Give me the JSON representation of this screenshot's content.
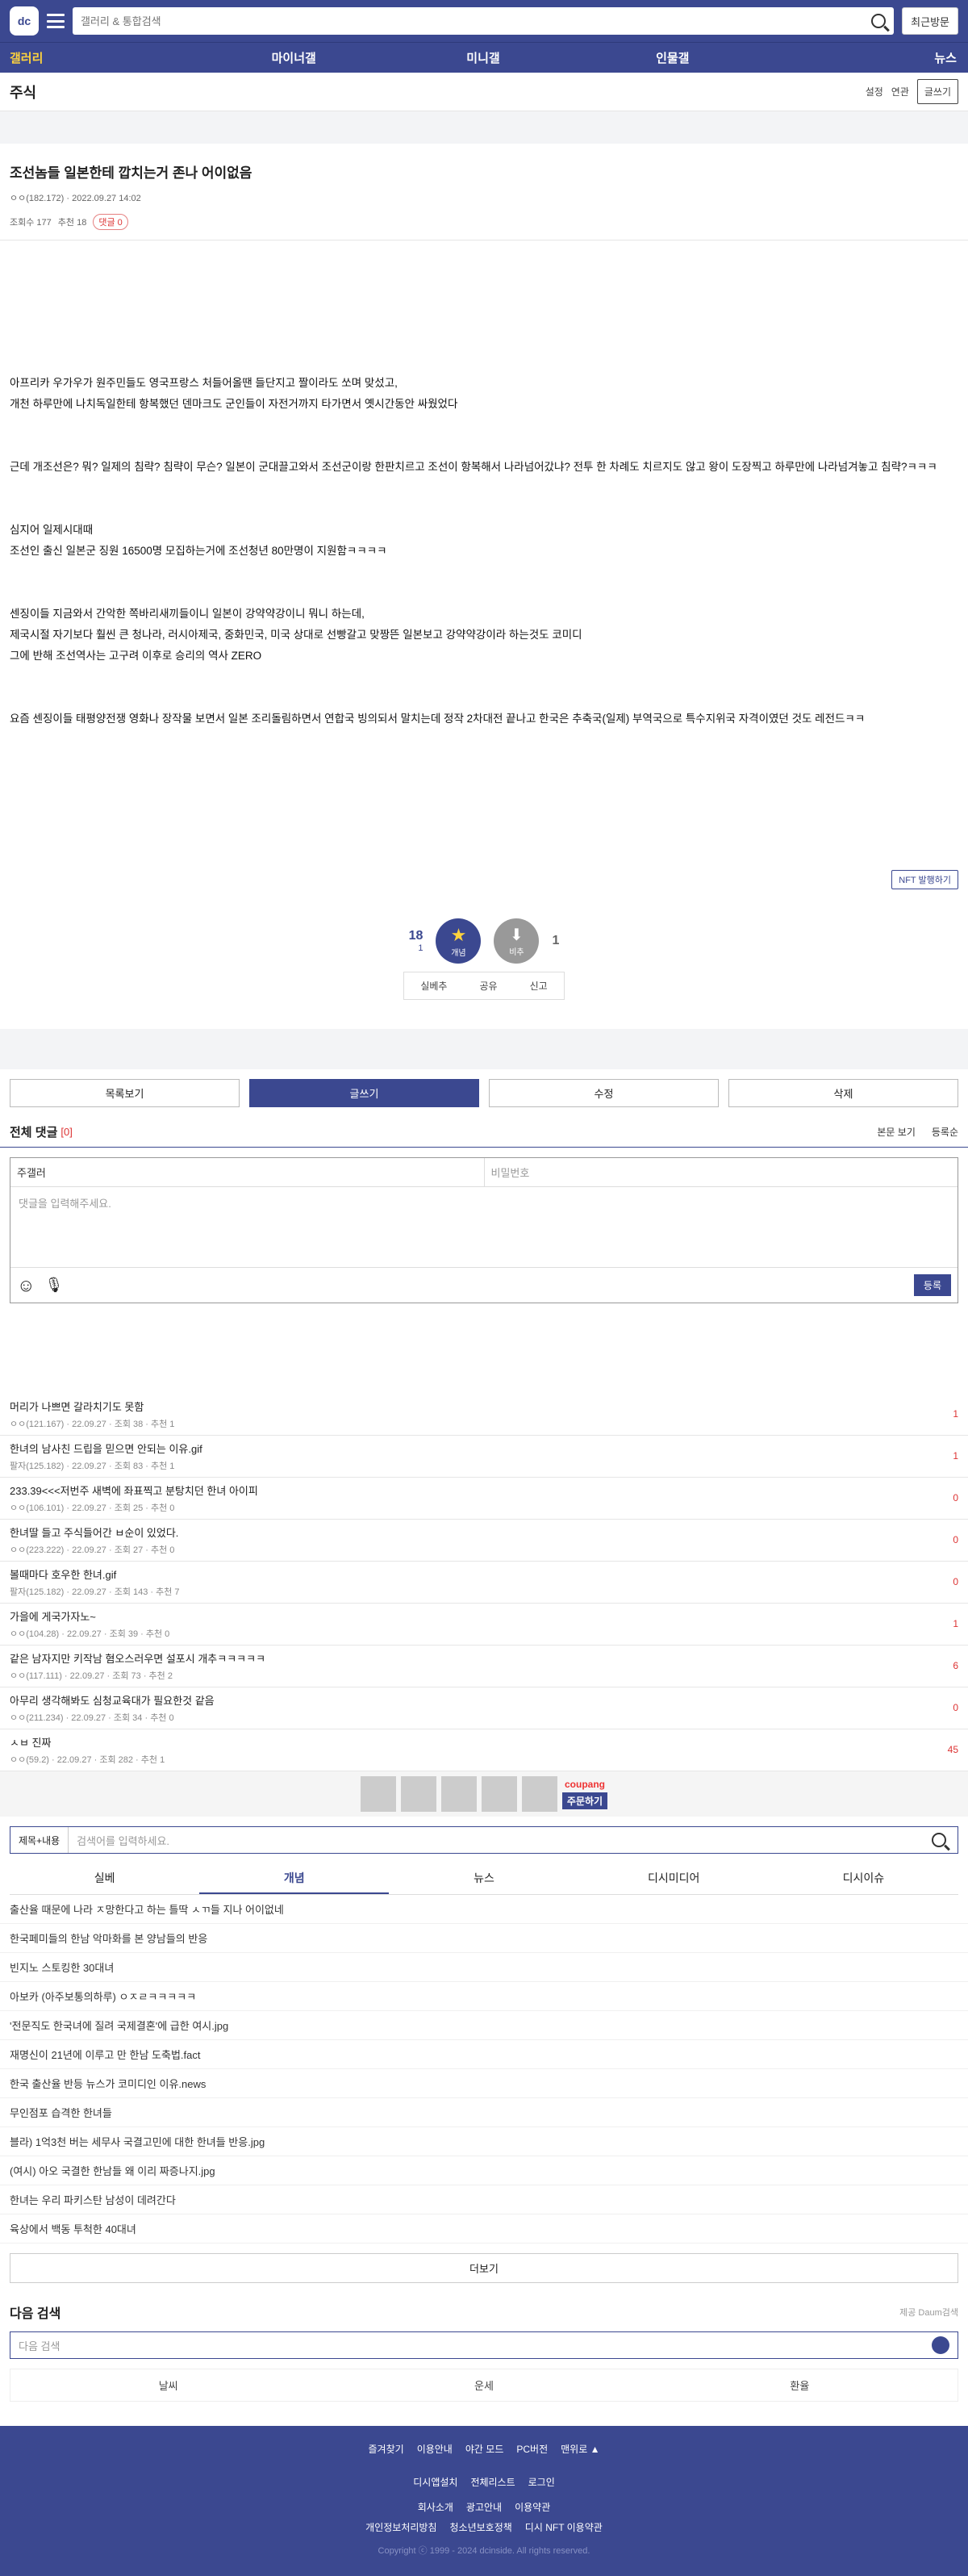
{
  "header": {
    "logo": "dc",
    "search_placeholder": "갤러리 & 통합검색",
    "recent": "최근방문"
  },
  "nav": [
    "갤러리",
    "마이너갤",
    "미니갤",
    "인물갤",
    "뉴스"
  ],
  "gallery": {
    "title": "주식",
    "settings": "설정",
    "related": "연관",
    "write": "글쓰기"
  },
  "post": {
    "title": "조선놈들 일본한테 깝치는거 존나 어이없음",
    "author": "ㅇㅇ(182.172)",
    "date": "2022.09.27 14:02",
    "views": "조회수 177",
    "recommend": "추천 18",
    "comments": "댓글 0",
    "body": [
      "",
      "",
      "",
      "",
      "아프리카 우가우가 원주민들도 영국프랑스 처들어올땐 들단지고 짤이라도 쏘며 맞섰고,",
      "개천 하루만에 나치독일한테 항복했던 덴마크도 군인들이 자전거까지 타가면서 옛시간동안 싸웠었다",
      "",
      "",
      "근데 개조선은? 뭐? 일제의 침략? 침략이 무슨? 일본이 군대끌고와서 조선군이랑 한판치르고 조선이 항복해서 나라넘어갔냐? 전투 한 차례도 치르지도 않고 왕이 도장찍고 하루만에 나라넘겨놓고 침략?ㅋㅋㅋ",
      "",
      "",
      "심지어 일제시대때",
      "조선인 출신 일본군 징원 16500명 모집하는거에 조선청년 80만명이 지원함ㅋㅋㅋㅋ",
      "",
      "",
      "센징이들 지금와서 간악한 쪽바리새끼들이니 일본이 강약약강이니 뭐니 하는데,",
      "제국시절 자기보다 훨씬 큰 청나라, 러시아제국, 중화민국, 미국 상대로 선빵갈고 맞짱뜬 일본보고 강약약강이라 하는것도 코미디",
      "그에 반해 조선역사는 고구려 이후로 승리의 역사 ZERO",
      "",
      "",
      "요즘 센징이들 태평양전쟁 영화나 장작물 보면서 일본 조리돌림하면서 연합국 빙의되서 말치는데 정작 2차대전 끝나고 한국은 추축국(일제) 부역국으로 특수지위국 자격이였던 것도 레전드ㅋㅋ"
    ],
    "nft": "NFT 발행하기",
    "up_count": "18",
    "up_sub": "1",
    "up_label": "개념",
    "down_label": "비추",
    "down_count": "1",
    "actions": [
      "실베추",
      "공유",
      "신고"
    ]
  },
  "buttons": [
    "목록보기",
    "글쓰기",
    "수정",
    "삭제"
  ],
  "comments": {
    "title": "전체 댓글",
    "count": "[0]",
    "view": "본문 보기",
    "sort": "등록순",
    "name": "주갤러",
    "pw": "비밀번호",
    "placeholder": "댓글을 입력해주세요.",
    "submit": "등록"
  },
  "list": [
    {
      "t": "머리가 나쁘면 갈라치기도 못함",
      "m": "ㅇㅇ(121.167) · 22.09.27 · 조회 38 · 추천 1",
      "n": "1"
    },
    {
      "t": "한녀의 남사친 드립을 믿으면 안되는 이유.gif",
      "m": "팔자(125.182) · 22.09.27 · 조회 83 · 추천 1",
      "n": "1"
    },
    {
      "t": "233.39<<<저번주 새벽에 좌표찍고 분탕치던 한녀 아이피",
      "m": "ㅇㅇ(106.101) · 22.09.27 · 조회 25 · 추천 0",
      "n": "0"
    },
    {
      "t": "한녀딸 들고 주식들어간 ㅂ순이 있었다.",
      "m": "ㅇㅇ(223.222) · 22.09.27 · 조회 27 · 추천 0",
      "n": "0"
    },
    {
      "t": "볼때마다 호우한 한녀.gif",
      "m": "팔자(125.182) · 22.09.27 · 조회 143 · 추천 7",
      "n": "0"
    },
    {
      "t": "가을에 게국가자노~",
      "m": "ㅇㅇ(104.28) · 22.09.27 · 조회 39 · 추천 0",
      "n": "1"
    },
    {
      "t": "같은 남자지만 키작남 혐오스러우면 설포시 개추ㅋㅋㅋㅋㅋ",
      "m": "ㅇㅇ(117.111) · 22.09.27 · 조회 73 · 추천 2",
      "n": "6"
    },
    {
      "t": "아무리 생각해봐도 심청교육대가 필요한것 같음",
      "m": "ㅇㅇ(211.234) · 22.09.27 · 조회 34 · 추천 0",
      "n": "0"
    },
    {
      "t": "ㅅㅂ 진짜",
      "m": "ㅇㅇ(59.2) · 22.09.27 · 조회 282 · 추천 1",
      "n": "45"
    }
  ],
  "ad": {
    "brand": "coupang",
    "cta": "주문하기"
  },
  "search": {
    "select": "제목+내용",
    "placeholder": "검색어를 입력하세요."
  },
  "tabs": [
    "실베",
    "개념",
    "뉴스",
    "디시미디어",
    "디시이슈"
  ],
  "best": [
    "출산율 때문에 나라 ㅈ망한다고 하는 틀딱 ㅅㄲ들 지나 어이없네",
    "한국페미들의 한남 악마화를 본 양남들의 반응",
    "빈지노 스토킹한 30대녀",
    "아보카 (아주보통의하루) ㅇㅈㄹㅋㅋㅋㅋㅋ",
    "'전문직도 한국녀에 질려 국제결혼'에 급한 여시.jpg",
    "재명신이 21년에 이루고 만 한남 도축법.fact",
    "한국 출산율 반등 뉴스가 코미디인 이유.news",
    "무인점포 습격한 한녀들",
    "블라) 1억3천 버는 세무사 국결고민에 대한 한녀들 반응.jpg",
    "(여시) 아오 국결한 한남들 왜 이리 짜증나지.jpg",
    "한녀는 우리 파키스탄 남성이 데려간다",
    "육상에서 백동 투척한 40대녀"
  ],
  "more": "더보기",
  "next": {
    "title": "다음 검색",
    "provider": "제공 Daum검색",
    "placeholder": "다음 검색",
    "keywords": [
      "날씨",
      "운세",
      "환율"
    ]
  },
  "footer": {
    "row1": [
      "즐겨찾기",
      "이용안내",
      "야간 모드",
      "PC버전",
      "맨위로 ▲"
    ],
    "row2": [
      "디시앱설치",
      "전체리스트",
      "로그인"
    ],
    "row3": [
      "회사소개",
      "광고안내",
      "이용약관"
    ],
    "row4": [
      "개인정보처리방침",
      "청소년보호정책",
      "디시 NFT 이용약관"
    ],
    "copyright": "Copyright ⓒ 1999 - 2024 dcinside. All rights reserved."
  }
}
